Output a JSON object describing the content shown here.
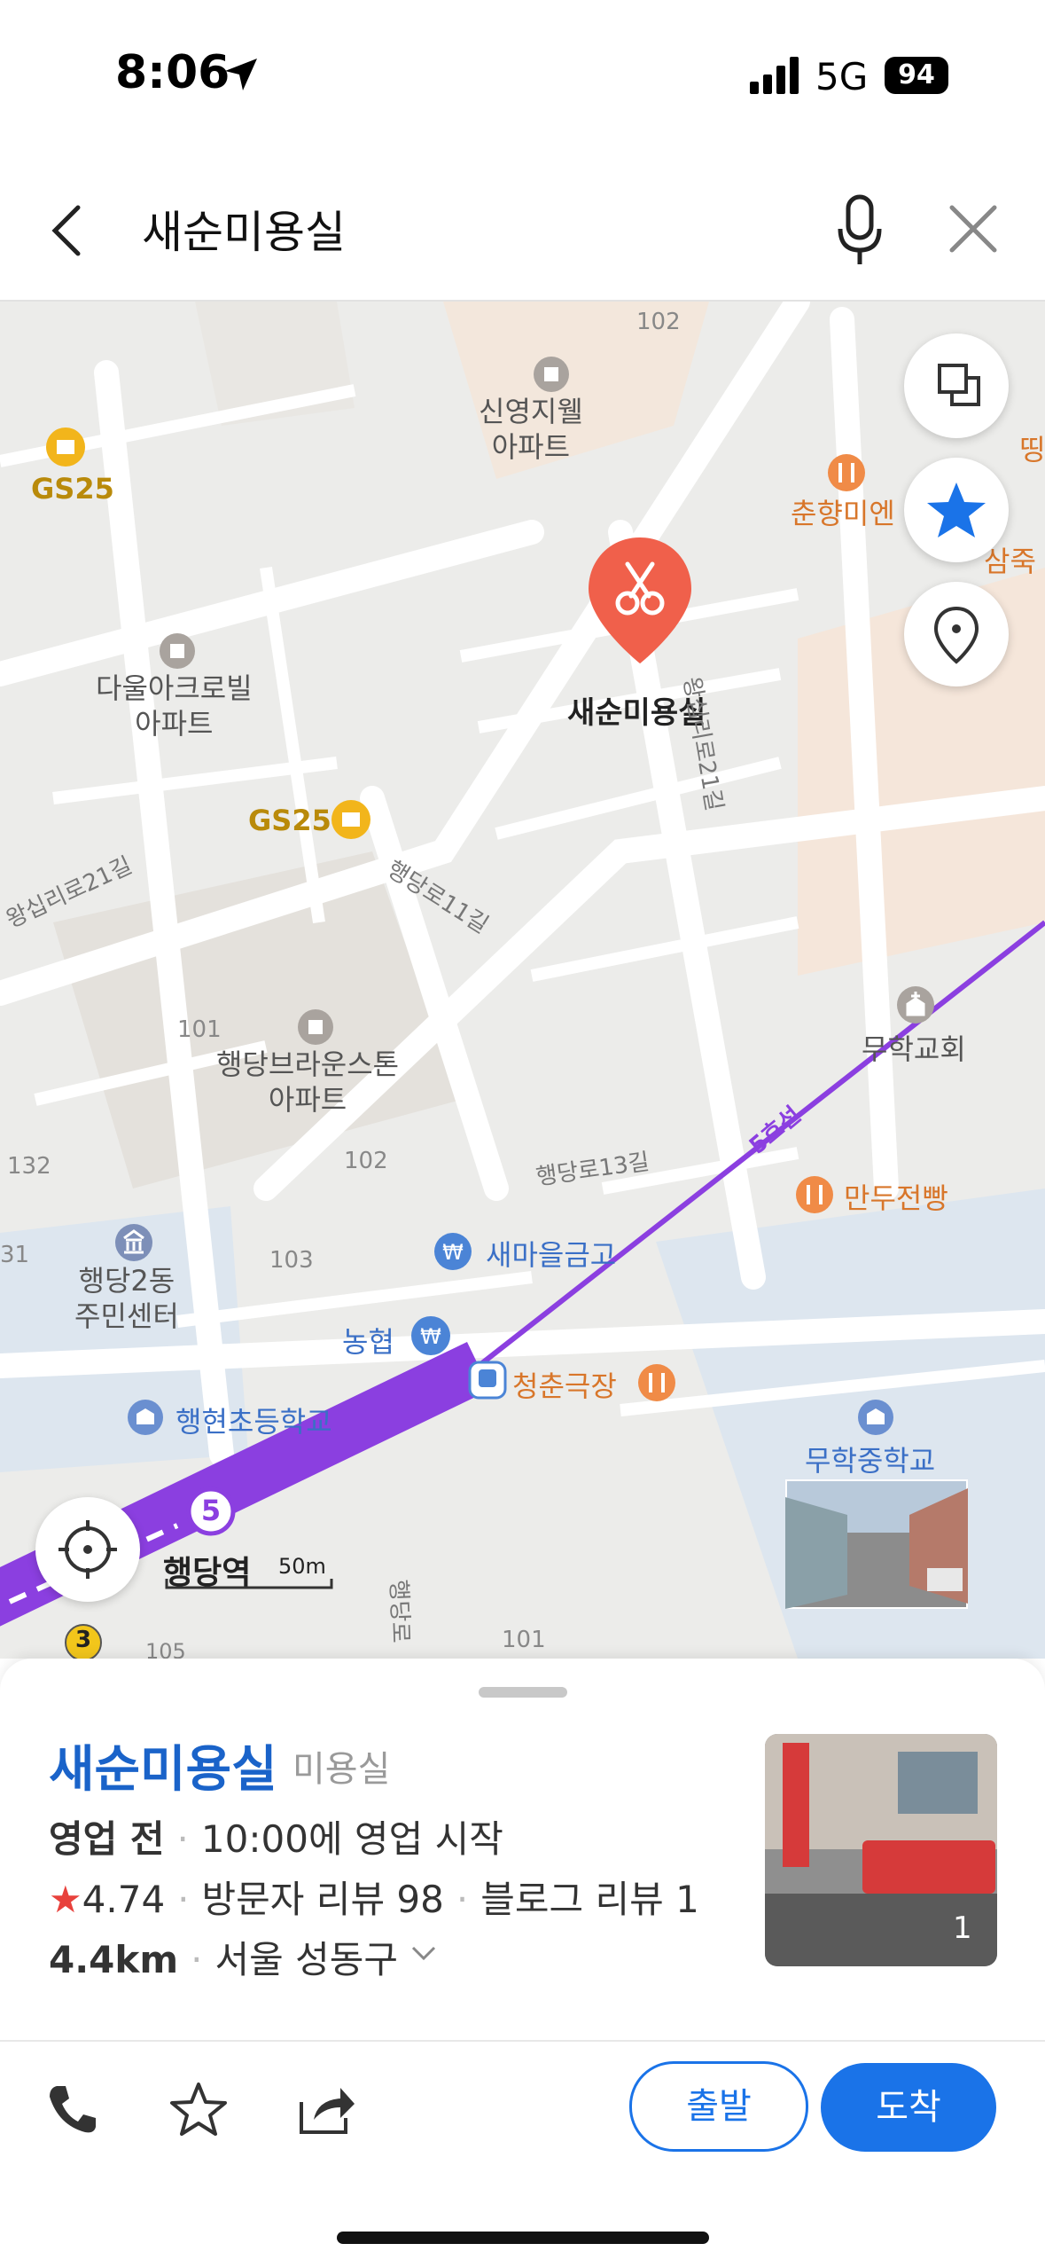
{
  "status_bar": {
    "time": "8:06",
    "network": "5G",
    "battery": "94"
  },
  "search": {
    "query": "새순미용실"
  },
  "map": {
    "labels": {
      "num_102_top": "102",
      "shinyoung": "신영지웰\n아파트",
      "gs25_top": "GS25",
      "chunhyang": "춘향미엔",
      "samjuk": "삼죽",
      "tteok": "띵",
      "selected": "새순미용실",
      "road_wangsimni21_right": "왕십리로21길",
      "daul": "다울아크로빌\n아파트",
      "gs25_mid": "GS25",
      "road_wangsimni21_left": "왕십리로21길",
      "road_haengdang11": "행당로11길",
      "num_101_mid": "101",
      "brownstone": "행당브라운스톤\n아파트",
      "muhak_church": "무학교회",
      "num_132": "132",
      "num_102_mid": "102",
      "road_haengdang13": "행당로13길",
      "line5": "5호선",
      "mandu": "만두전빵",
      "num_31": "31",
      "num_103": "103",
      "community": "행당2동\n주민센터",
      "saemaeul": "새마을금고",
      "nonghyup": "농협",
      "cheongchun": "청춘극장",
      "haenghyeon": "행현초등학교",
      "muhak_middle": "무학중학교",
      "station": "행당역",
      "scale": "50m",
      "num_101_bottom": "101",
      "num_105": "105",
      "road_haengdang_bottom": "행당로",
      "line5_badge": "5",
      "exit3": "3"
    }
  },
  "place": {
    "name": "새순미용실",
    "category": "미용실",
    "status": "영업 전",
    "hours": "10:00에 영업 시작",
    "rating": "4.74",
    "visitor_reviews": "방문자 리뷰 98",
    "blog_reviews": "블로그 리뷰 1",
    "distance": "4.4km",
    "address": "서울 성동구",
    "photo_count": "1",
    "star_symbol": "★"
  },
  "actions": {
    "depart": "출발",
    "arrive": "도착"
  },
  "colors": {
    "accent": "#1a73e8",
    "marker": "#f0604b",
    "subway": "#8b3fe0",
    "star": "#e8413c"
  }
}
